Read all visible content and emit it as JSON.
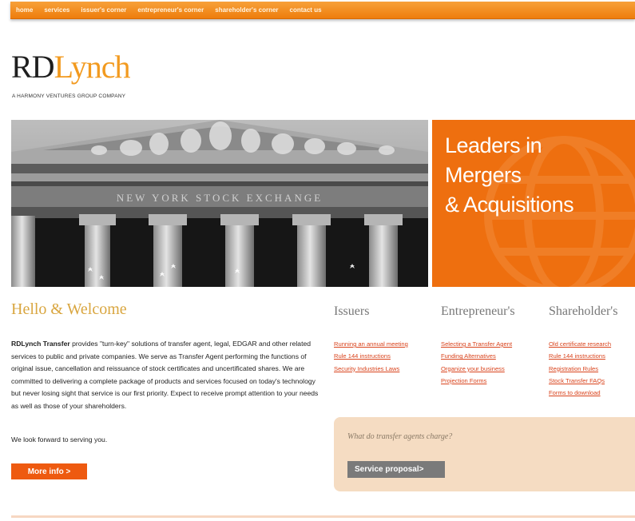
{
  "nav": {
    "items": [
      "home",
      "services",
      "issuer's corner",
      "entrepreneur's corner",
      "shareholder's corner",
      "contact us"
    ]
  },
  "logo": {
    "part1": "RD",
    "part2": "Lynch"
  },
  "tagline": "A HARMONY VENTURES GROUP COMPANY",
  "hero": {
    "image_text": "NEW YORK STOCK EXCHANGE",
    "headline": [
      "Leaders in",
      "Mergers",
      "& Acquisitions"
    ]
  },
  "welcome": {
    "title": "Hello & Welcome",
    "intro_bold": "RDLynch Transfer",
    "intro_rest": " provides \"turn-key\" solutions of transfer agent, legal, EDGAR and other related services to public and private companies. We serve as Transfer Agent performing the functions of original issue, cancellation and reissuance of stock certificates and uncertificated shares. We are committed to delivering a complete package of products and services focused on today's technology but never losing sight that service is our first priority. Expect to receive prompt attention to your needs as well as those of your shareholders.",
    "closing": "We look forward to serving you.",
    "more_button": "More info >"
  },
  "columns": [
    {
      "heading": "Issuers",
      "links": [
        "Running an annual meeting",
        "Rule 144 instructions",
        "Security Industries Laws"
      ]
    },
    {
      "heading": "Entrepreneur's",
      "links": [
        "Selecting a Transfer Agent",
        "Funding Alternatives",
        "Organize your business",
        "Projection Forms"
      ]
    },
    {
      "heading": "Shareholder's",
      "links": [
        "Old certificate research",
        "Rule 144 instructions",
        "Registration Rules",
        "Stock Transfer FAQs",
        "Forms to download"
      ]
    }
  ],
  "proposal": {
    "question": "What do transfer agents charge?",
    "button": "Service proposal>"
  },
  "colors": {
    "brand_orange": "#ee6f0f",
    "logo_orange": "#f29a1f",
    "link_red": "#d9431c",
    "welcome_gold": "#d9a640"
  }
}
